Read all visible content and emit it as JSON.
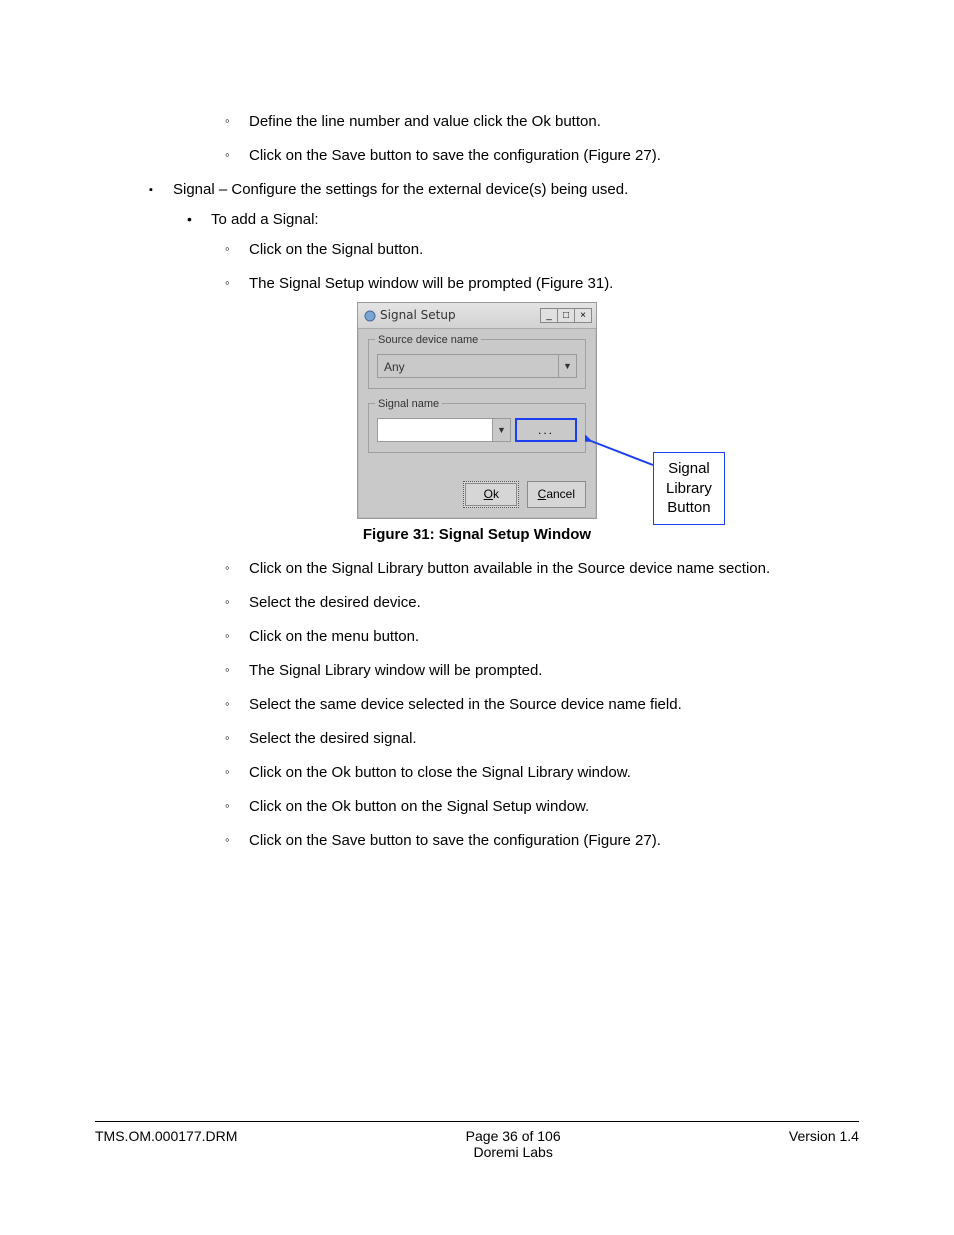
{
  "pre_bullets": [
    "Define the line number and value click the Ok button.",
    "Click on the Save button to save the configuration (Figure 27)."
  ],
  "signal_heading": "Signal – Configure the settings for the external device(s) being used.",
  "add_signal_label": "To add a Signal:",
  "steps_before_fig": [
    "Click on the Signal button.",
    "The Signal Setup window will be prompted (Figure 31)."
  ],
  "dialog": {
    "title": "Signal Setup",
    "group1_label": "Source device name",
    "source_value": "Any",
    "group2_label": "Signal name",
    "signal_value": "",
    "dots": "...",
    "ok_full": "Ok",
    "ok_prefix": "O",
    "ok_rest": "k",
    "cancel_full": "Cancel",
    "cancel_prefix": "C",
    "cancel_rest": "ancel"
  },
  "callout_line1": "Signal Library",
  "callout_line2": "Button",
  "figure_caption": "Figure 31: Signal Setup Window",
  "steps_after_fig": [
    "Click on the Signal Library button available in the Source device name section.",
    "Select the desired device.",
    "Click on the menu button.",
    "The Signal Library window will be prompted.",
    "Select the same device selected in the Source device name field.",
    "Select the desired signal.",
    "Click on the Ok button to close the Signal Library window.",
    "Click on the Ok button on the Signal Setup window.",
    "Click on the Save button to save the configuration (Figure 27)."
  ],
  "footer": {
    "left": "TMS.OM.000177.DRM",
    "center_top": "Page 36 of 106",
    "center_bottom": "Doremi Labs",
    "right": "Version 1.4"
  }
}
